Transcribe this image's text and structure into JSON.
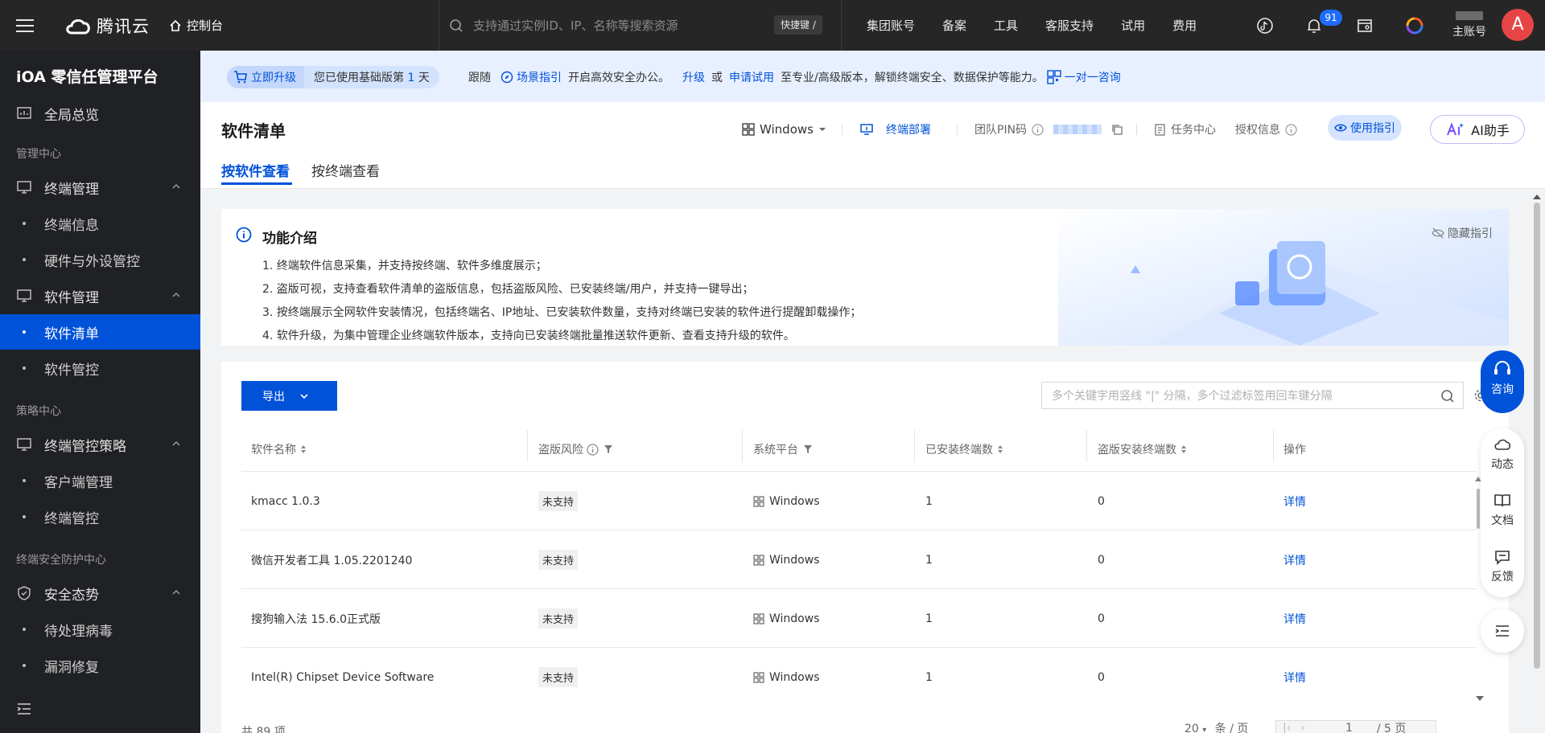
{
  "topbar": {
    "brand": "腾讯云",
    "console": "控制台",
    "search_placeholder": "支持通过实例ID、IP、名称等搜索资源",
    "shortcut": "快捷键 /",
    "nav": [
      "集团账号",
      "备案",
      "工具",
      "客服支持",
      "试用",
      "费用"
    ],
    "notification_count": "91",
    "account_label": "主账号",
    "avatar_letter": "A"
  },
  "sidebar": {
    "title": "iOA 零信任管理平台",
    "overview": "全局总览",
    "section_manage": "管理中心",
    "endpoint_mgmt": "终端管理",
    "endpoint_info": "终端信息",
    "hardware": "硬件与外设管控",
    "software_mgmt": "软件管理",
    "software_list": "软件清单",
    "software_control": "软件管控",
    "section_policy": "策略中心",
    "endpoint_policy": "终端管控策略",
    "client_mgmt": "客户端管理",
    "endpoint_control": "终端管控",
    "section_security": "终端安全防护中心",
    "security_posture": "安全态势",
    "pending_virus": "待处理病毒",
    "vuln_fix": "漏洞修复"
  },
  "banner": {
    "upgrade_btn": "立即升级",
    "using_prefix": "您已使用基础版第",
    "days": "1",
    "days_suffix": "天",
    "follow": "跟随",
    "scene_guide": "场景指引",
    "enable_text": "开启高效安全办公。",
    "upgrade": "升级",
    "or": "或",
    "apply_trial": "申请试用",
    "pro_text": "至专业/高级版本，解锁终端安全、数据保护等能力。",
    "consult": "一对一咨询"
  },
  "header": {
    "title": "软件清单",
    "platform": "Windows",
    "deploy": "终端部署",
    "team_pin": "团队PIN码",
    "task_center": "任务中心",
    "auth_info": "授权信息",
    "guide": "使用指引",
    "ai": "AI助手",
    "tabs": [
      "按软件查看",
      "按终端查看"
    ]
  },
  "intro": {
    "title": "功能介绍",
    "hide": "隐藏指引",
    "lines": [
      "1. 终端软件信息采集，并支持按终端、软件多维度展示；",
      "2. 盗版可视，支持查看软件清单的盗版信息，包括盗版风险、已安装终端/用户，并支持一键导出；",
      "3. 按终端展示全网软件安装情况，包括终端名、IP地址、已安装软件数量，支持对终端已安装的软件进行提醒卸载操作；",
      "4. 软件升级，为集中管理企业终端软件版本，支持向已安装终端批量推送软件更新、查看支持升级的软件。"
    ]
  },
  "table": {
    "export": "导出",
    "search_placeholder": "多个关键字用竖线 \"|\" 分隔，多个过滤标签用回车键分隔",
    "columns": [
      "软件名称",
      "盗版风险",
      "系统平台",
      "已安装终端数",
      "盗版安装终端数",
      "操作"
    ],
    "rows": [
      {
        "name": "kmacc 1.0.3",
        "risk": "未支持",
        "platform": "Windows",
        "installed": "1",
        "pirated": "0",
        "action": "详情"
      },
      {
        "name": "微信开发者工具 1.05.2201240",
        "risk": "未支持",
        "platform": "Windows",
        "installed": "1",
        "pirated": "0",
        "action": "详情"
      },
      {
        "name": "搜狗输入法 15.6.0正式版",
        "risk": "未支持",
        "platform": "Windows",
        "installed": "1",
        "pirated": "0",
        "action": "详情"
      },
      {
        "name": "Intel(R) Chipset Device Software",
        "risk": "未支持",
        "platform": "Windows",
        "installed": "1",
        "pirated": "0",
        "action": "详情"
      }
    ],
    "total": "共 89 项",
    "page_size": "20",
    "per_page": "条 / 页",
    "page": "1",
    "pages": "/ 5 页"
  },
  "float": {
    "consult": "咨询",
    "news": "动态",
    "docs": "文档",
    "feedback": "反馈"
  },
  "colors": {
    "primary": "#0052d9",
    "topbar": "#262626",
    "sidebar": "#202124",
    "badge": "#1f6bff",
    "avatar": "#e54545"
  }
}
